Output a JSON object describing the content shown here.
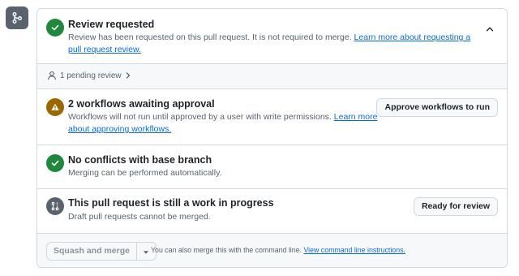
{
  "review": {
    "title": "Review requested",
    "description": "Review has been requested on this pull request. It is not required to merge.",
    "link": "Learn more about requesting a pull request review."
  },
  "pending": {
    "label": "1 pending review"
  },
  "workflows": {
    "title": "2 workflows awaiting approval",
    "description": "Workflows will not run until approved by a user with write permissions.",
    "link": "Learn more about approving workflows.",
    "button": "Approve workflows to run"
  },
  "conflicts": {
    "title": "No conflicts with base branch",
    "description": "Merging can be performed automatically."
  },
  "wip": {
    "title": "This pull request is still a work in progress",
    "description": "Draft pull requests cannot be merged.",
    "button": "Ready for review"
  },
  "merge": {
    "button": "Squash and merge",
    "note": "You can also merge this with the command line.",
    "link": "View command line instructions."
  },
  "icons": {
    "left": "git-merge-icon",
    "review": "check-circle-icon",
    "pending": "person-icon",
    "workflows": "alert-icon",
    "conflicts": "check-circle-icon",
    "wip": "git-pull-request-draft-icon"
  },
  "colors": {
    "success": "#1f883d",
    "attention": "#9a6700",
    "neutral": "#59636e",
    "link": "#0969da"
  }
}
